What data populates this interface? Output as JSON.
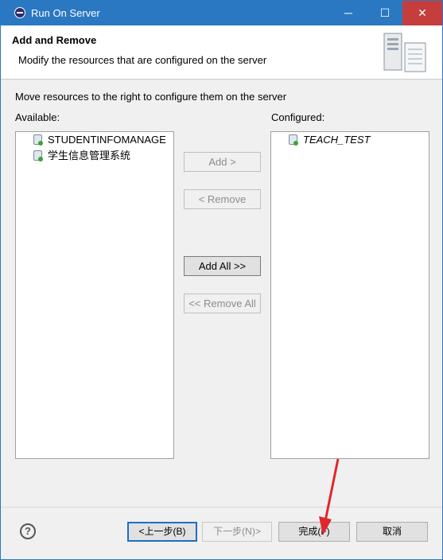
{
  "window": {
    "title": "Run On Server",
    "controls": {
      "minimize": "─",
      "maximize": "☐",
      "close": "✕"
    }
  },
  "header": {
    "title": "Add and Remove",
    "description": "Modify the resources that are configured on the server"
  },
  "instructions": "Move resources to the right to configure them on the server",
  "available": {
    "label": "Available:",
    "items": [
      "STUDENTINFOMANAGE",
      "学生信息管理系统"
    ]
  },
  "configured": {
    "label": "Configured:",
    "items": [
      "TEACH_TEST"
    ]
  },
  "buttons": {
    "add": "Add >",
    "remove": "< Remove",
    "add_all": "Add All >>",
    "remove_all": "<< Remove All"
  },
  "footer": {
    "help": "?",
    "back": "<上一步(B)",
    "next": "下一步(N)>",
    "finish": "完成(F)",
    "cancel": "取消"
  },
  "colors": {
    "titlebar": "#2b78c2",
    "close_button": "#c63d3d",
    "annotation_arrow": "#e0272b"
  }
}
